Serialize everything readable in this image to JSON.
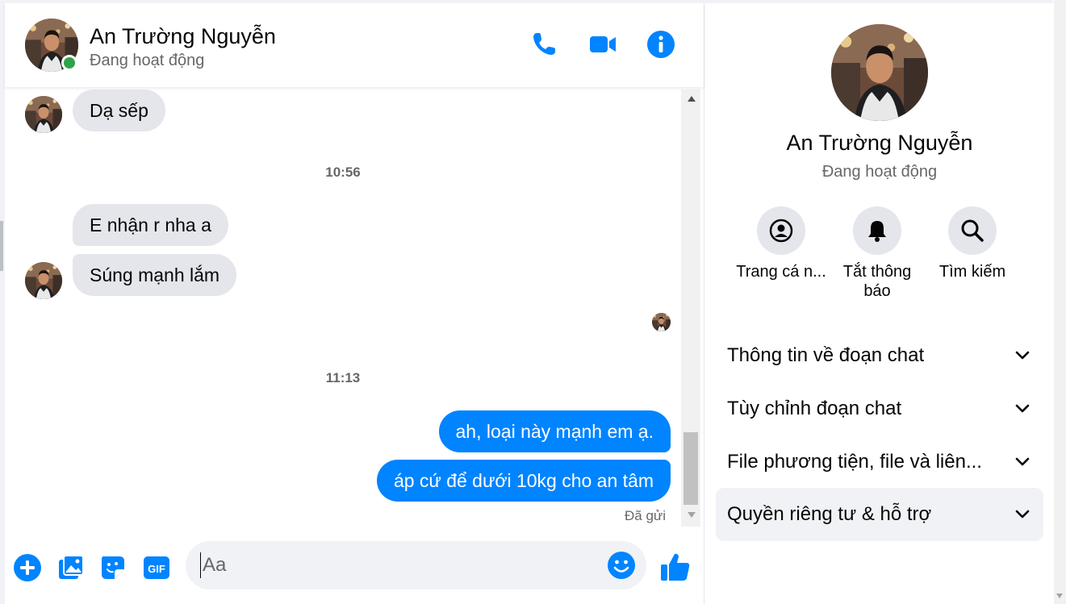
{
  "conversation": {
    "name": "An Trường Nguyễn",
    "status": "Đang hoạt động"
  },
  "header": {
    "icons": [
      "phone-icon",
      "video-camera-icon",
      "info-icon"
    ]
  },
  "messages": {
    "time_1": "10:56",
    "time_2": "11:13",
    "incoming": [
      "Dạ sếp",
      "E nhận r nha a",
      "Súng mạnh lắm"
    ],
    "outgoing": [
      "ah, loại này mạnh em ạ.",
      "áp cứ để dưới 10kg cho an tâm"
    ],
    "sent_status": "Đã gửi"
  },
  "composer": {
    "placeholder": "Aa",
    "icons": [
      "plus-icon",
      "photo-icon",
      "sticker-icon",
      "gif-icon",
      "emoji-icon",
      "like-icon"
    ]
  },
  "sidebar": {
    "actions": [
      {
        "label": "Trang cá n...",
        "icon": "profile-icon"
      },
      {
        "label": "Tắt thông báo",
        "icon": "bell-icon"
      },
      {
        "label": "Tìm kiếm",
        "icon": "search-icon"
      }
    ],
    "sections": [
      {
        "label": "Thông tin về đoạn chat"
      },
      {
        "label": "Tùy chỉnh đoạn chat"
      },
      {
        "label": "File phương tiện, file và liên..."
      },
      {
        "label": "Quyền riêng tư & hỗ trợ"
      }
    ]
  },
  "colors": {
    "accent": "#0084ff",
    "online": "#31a24c",
    "incoming_bubble": "#e4e6eb",
    "secondary_text": "#65676b"
  }
}
